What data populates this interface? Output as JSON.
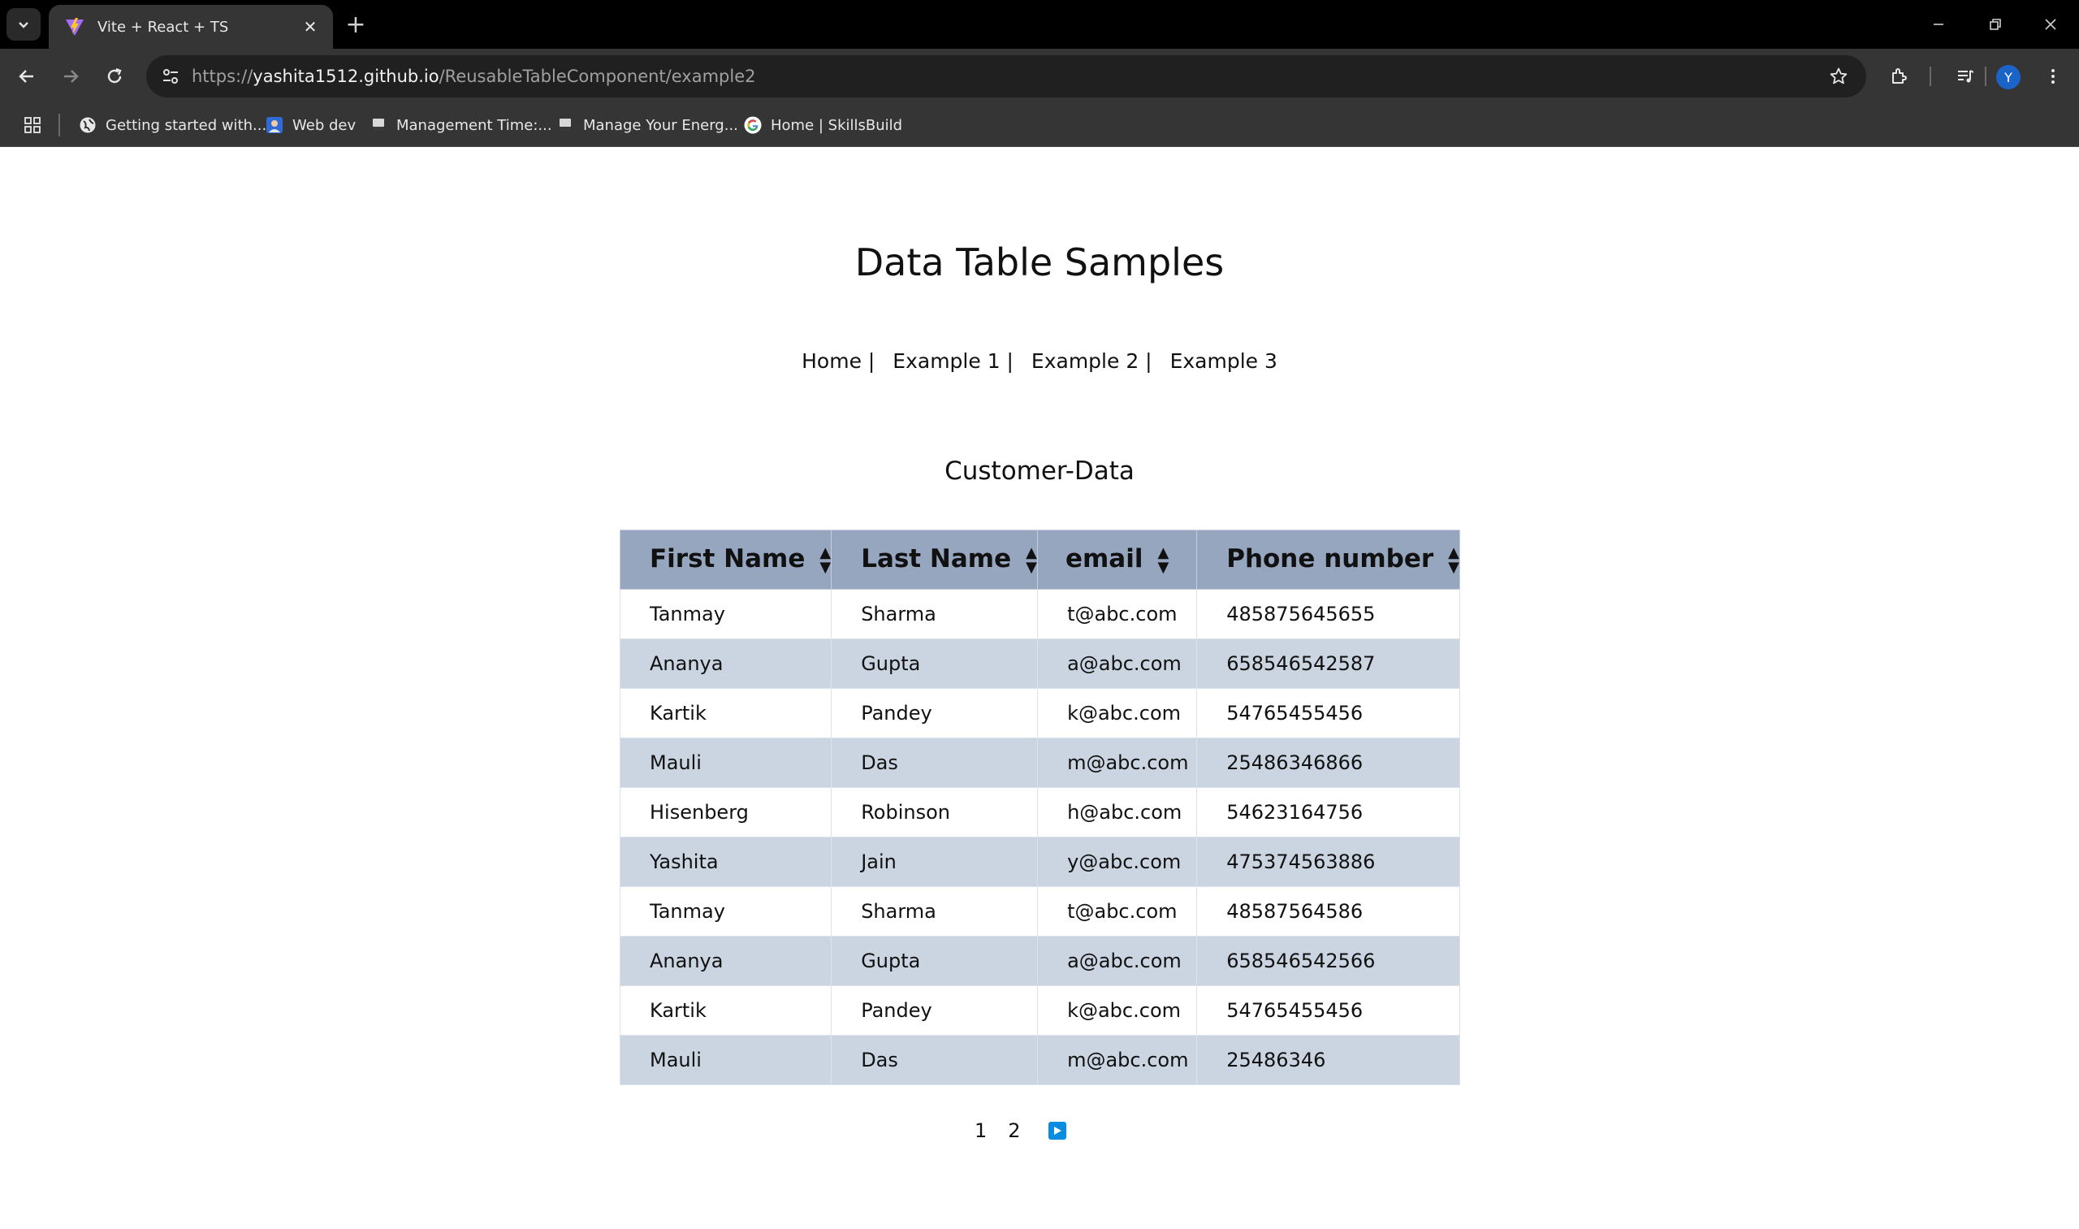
{
  "browser": {
    "tab_title": "Vite + React + TS",
    "url_scheme": "https://",
    "url_host": "yashita1512.github.io",
    "url_path": "/ReusableTableComponent/example2",
    "profile_initial": "Y",
    "bookmarks": [
      {
        "label": "Getting started with...",
        "icon": "globe-icon"
      },
      {
        "label": "Web dev",
        "icon": "image-icon"
      },
      {
        "label": "Management Time:...",
        "icon": "page-icon"
      },
      {
        "label": "Manage Your Energ...",
        "icon": "page-icon"
      },
      {
        "label": "Home | SkillsBuild",
        "icon": "google-icon"
      }
    ]
  },
  "page": {
    "title": "Data Table Samples",
    "nav": {
      "home": "Home |",
      "example1": "Example 1 |",
      "example2": "Example 2 |",
      "example3": "Example 3"
    },
    "section_title": "Customer-Data"
  },
  "table": {
    "columns": [
      "First Name",
      "Last Name",
      "email",
      "Phone number"
    ],
    "rows": [
      [
        "Tanmay",
        "Sharma",
        "t@abc.com",
        "485875645655"
      ],
      [
        "Ananya",
        "Gupta",
        "a@abc.com",
        "658546542587"
      ],
      [
        "Kartik",
        "Pandey",
        "k@abc.com",
        "54765455456"
      ],
      [
        "Mauli",
        "Das",
        "m@abc.com",
        "25486346866"
      ],
      [
        "Hisenberg",
        "Robinson",
        "h@abc.com",
        "54623164756"
      ],
      [
        "Yashita",
        "Jain",
        "y@abc.com",
        "475374563886"
      ],
      [
        "Tanmay",
        "Sharma",
        "t@abc.com",
        "48587564586"
      ],
      [
        "Ananya",
        "Gupta",
        "a@abc.com",
        "658546542566"
      ],
      [
        "Kartik",
        "Pandey",
        "k@abc.com",
        "54765455456"
      ],
      [
        "Mauli",
        "Das",
        "m@abc.com",
        "25486346"
      ]
    ]
  },
  "pagination": {
    "pages": [
      "1",
      "2"
    ],
    "next_icon": "play-icon"
  },
  "colors": {
    "header_bg": "#96a6bf",
    "alt_row_bg": "#cbd5e1",
    "next_button": "#0a8de0",
    "avatar": "#1a63c7"
  }
}
